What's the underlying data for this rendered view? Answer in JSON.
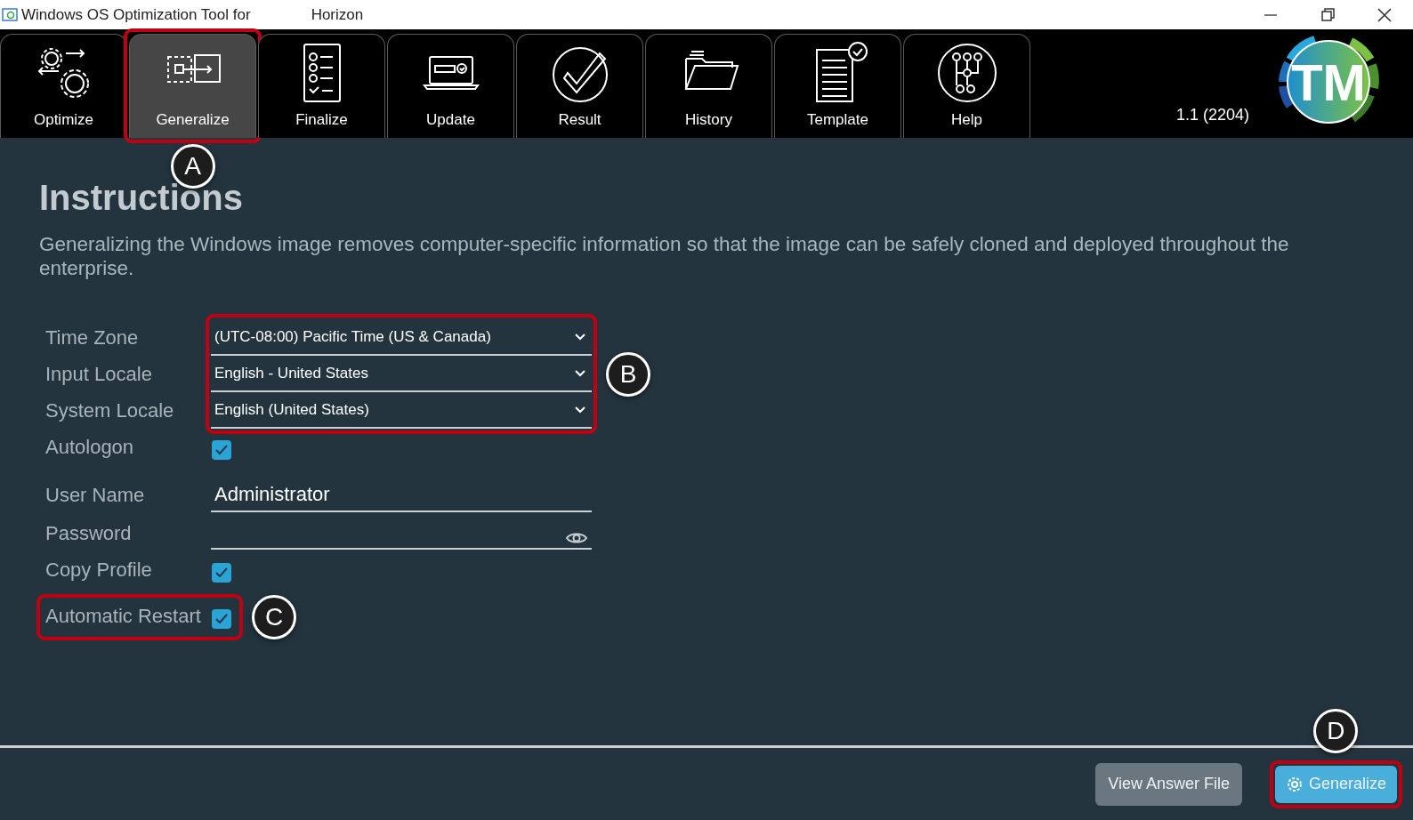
{
  "window": {
    "title_parts": [
      "Windows OS Optimization Tool for",
      "Horizon"
    ]
  },
  "tabs": [
    {
      "label": "Optimize",
      "selected": false,
      "highlighted": false
    },
    {
      "label": "Generalize",
      "selected": true,
      "highlighted": true,
      "callout": "A"
    },
    {
      "label": "Finalize",
      "selected": false,
      "highlighted": false
    },
    {
      "label": "Update",
      "selected": false,
      "highlighted": false
    },
    {
      "label": "Result",
      "selected": false,
      "highlighted": false
    },
    {
      "label": "History",
      "selected": false,
      "highlighted": false
    },
    {
      "label": "Template",
      "selected": false,
      "highlighted": false
    },
    {
      "label": "Help",
      "selected": false,
      "highlighted": false
    }
  ],
  "version": "1.1 (2204)",
  "logo": {
    "text": "TM"
  },
  "instructions": {
    "title": "Instructions",
    "text": "Generalizing the Windows image removes computer-specific information so that the image can be safely cloned and deployed throughout the enterprise."
  },
  "form": {
    "fields": [
      {
        "kind": "dropdown",
        "label": "Time Zone",
        "value": "(UTC-08:00) Pacific Time (US & Canada)",
        "highlighted": true
      },
      {
        "kind": "dropdown",
        "label": "Input Locale",
        "value": "English - United States",
        "highlighted": true,
        "callout": "B"
      },
      {
        "kind": "dropdown",
        "label": "System Locale",
        "value": "English (United States)",
        "highlighted": true
      },
      {
        "kind": "checkbox",
        "label": "Autologon",
        "checked": true,
        "highlighted": false
      },
      {
        "kind": "text",
        "label": "User Name",
        "value": "Administrator",
        "highlighted": false
      },
      {
        "kind": "password",
        "label": "Password",
        "highlighted": false
      },
      {
        "kind": "checkbox",
        "label": "Copy Profile",
        "checked": true,
        "highlighted": false
      },
      {
        "kind": "checkbox",
        "label": "Automatic Restart",
        "checked": true,
        "highlighted": true,
        "callout": "C"
      }
    ]
  },
  "footer": {
    "buttons": [
      {
        "kind": "secondary",
        "label": "View Answer File",
        "highlighted": false
      },
      {
        "kind": "primary",
        "label": "Generalize",
        "highlighted": true,
        "callout": "D"
      }
    ]
  }
}
